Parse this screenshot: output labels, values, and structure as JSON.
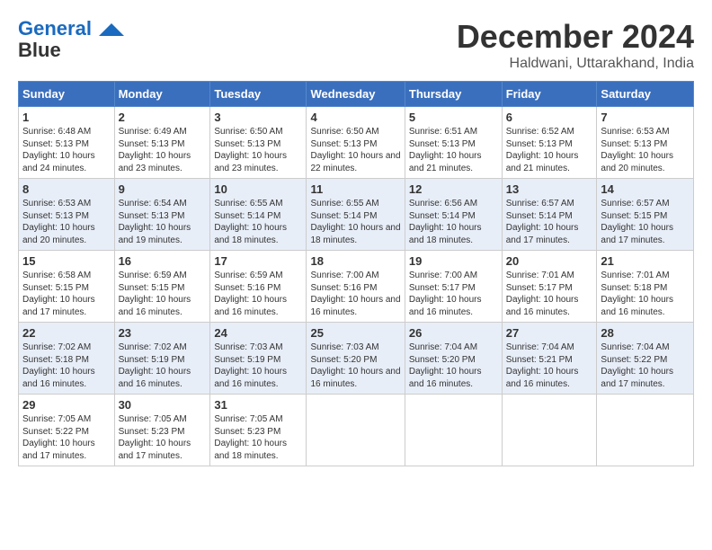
{
  "header": {
    "logo_line1": "General",
    "logo_line2": "Blue",
    "month": "December 2024",
    "location": "Haldwani, Uttarakhand, India"
  },
  "weekdays": [
    "Sunday",
    "Monday",
    "Tuesday",
    "Wednesday",
    "Thursday",
    "Friday",
    "Saturday"
  ],
  "weeks": [
    [
      {
        "day": "1",
        "info": "Sunrise: 6:48 AM\nSunset: 5:13 PM\nDaylight: 10 hours and 24 minutes."
      },
      {
        "day": "2",
        "info": "Sunrise: 6:49 AM\nSunset: 5:13 PM\nDaylight: 10 hours and 23 minutes."
      },
      {
        "day": "3",
        "info": "Sunrise: 6:50 AM\nSunset: 5:13 PM\nDaylight: 10 hours and 23 minutes."
      },
      {
        "day": "4",
        "info": "Sunrise: 6:50 AM\nSunset: 5:13 PM\nDaylight: 10 hours and 22 minutes."
      },
      {
        "day": "5",
        "info": "Sunrise: 6:51 AM\nSunset: 5:13 PM\nDaylight: 10 hours and 21 minutes."
      },
      {
        "day": "6",
        "info": "Sunrise: 6:52 AM\nSunset: 5:13 PM\nDaylight: 10 hours and 21 minutes."
      },
      {
        "day": "7",
        "info": "Sunrise: 6:53 AM\nSunset: 5:13 PM\nDaylight: 10 hours and 20 minutes."
      }
    ],
    [
      {
        "day": "8",
        "info": "Sunrise: 6:53 AM\nSunset: 5:13 PM\nDaylight: 10 hours and 20 minutes."
      },
      {
        "day": "9",
        "info": "Sunrise: 6:54 AM\nSunset: 5:13 PM\nDaylight: 10 hours and 19 minutes."
      },
      {
        "day": "10",
        "info": "Sunrise: 6:55 AM\nSunset: 5:14 PM\nDaylight: 10 hours and 18 minutes."
      },
      {
        "day": "11",
        "info": "Sunrise: 6:55 AM\nSunset: 5:14 PM\nDaylight: 10 hours and 18 minutes."
      },
      {
        "day": "12",
        "info": "Sunrise: 6:56 AM\nSunset: 5:14 PM\nDaylight: 10 hours and 18 minutes."
      },
      {
        "day": "13",
        "info": "Sunrise: 6:57 AM\nSunset: 5:14 PM\nDaylight: 10 hours and 17 minutes."
      },
      {
        "day": "14",
        "info": "Sunrise: 6:57 AM\nSunset: 5:15 PM\nDaylight: 10 hours and 17 minutes."
      }
    ],
    [
      {
        "day": "15",
        "info": "Sunrise: 6:58 AM\nSunset: 5:15 PM\nDaylight: 10 hours and 17 minutes."
      },
      {
        "day": "16",
        "info": "Sunrise: 6:59 AM\nSunset: 5:15 PM\nDaylight: 10 hours and 16 minutes."
      },
      {
        "day": "17",
        "info": "Sunrise: 6:59 AM\nSunset: 5:16 PM\nDaylight: 10 hours and 16 minutes."
      },
      {
        "day": "18",
        "info": "Sunrise: 7:00 AM\nSunset: 5:16 PM\nDaylight: 10 hours and 16 minutes."
      },
      {
        "day": "19",
        "info": "Sunrise: 7:00 AM\nSunset: 5:17 PM\nDaylight: 10 hours and 16 minutes."
      },
      {
        "day": "20",
        "info": "Sunrise: 7:01 AM\nSunset: 5:17 PM\nDaylight: 10 hours and 16 minutes."
      },
      {
        "day": "21",
        "info": "Sunrise: 7:01 AM\nSunset: 5:18 PM\nDaylight: 10 hours and 16 minutes."
      }
    ],
    [
      {
        "day": "22",
        "info": "Sunrise: 7:02 AM\nSunset: 5:18 PM\nDaylight: 10 hours and 16 minutes."
      },
      {
        "day": "23",
        "info": "Sunrise: 7:02 AM\nSunset: 5:19 PM\nDaylight: 10 hours and 16 minutes."
      },
      {
        "day": "24",
        "info": "Sunrise: 7:03 AM\nSunset: 5:19 PM\nDaylight: 10 hours and 16 minutes."
      },
      {
        "day": "25",
        "info": "Sunrise: 7:03 AM\nSunset: 5:20 PM\nDaylight: 10 hours and 16 minutes."
      },
      {
        "day": "26",
        "info": "Sunrise: 7:04 AM\nSunset: 5:20 PM\nDaylight: 10 hours and 16 minutes."
      },
      {
        "day": "27",
        "info": "Sunrise: 7:04 AM\nSunset: 5:21 PM\nDaylight: 10 hours and 16 minutes."
      },
      {
        "day": "28",
        "info": "Sunrise: 7:04 AM\nSunset: 5:22 PM\nDaylight: 10 hours and 17 minutes."
      }
    ],
    [
      {
        "day": "29",
        "info": "Sunrise: 7:05 AM\nSunset: 5:22 PM\nDaylight: 10 hours and 17 minutes."
      },
      {
        "day": "30",
        "info": "Sunrise: 7:05 AM\nSunset: 5:23 PM\nDaylight: 10 hours and 17 minutes."
      },
      {
        "day": "31",
        "info": "Sunrise: 7:05 AM\nSunset: 5:23 PM\nDaylight: 10 hours and 18 minutes."
      },
      {
        "day": "",
        "info": ""
      },
      {
        "day": "",
        "info": ""
      },
      {
        "day": "",
        "info": ""
      },
      {
        "day": "",
        "info": ""
      }
    ]
  ]
}
